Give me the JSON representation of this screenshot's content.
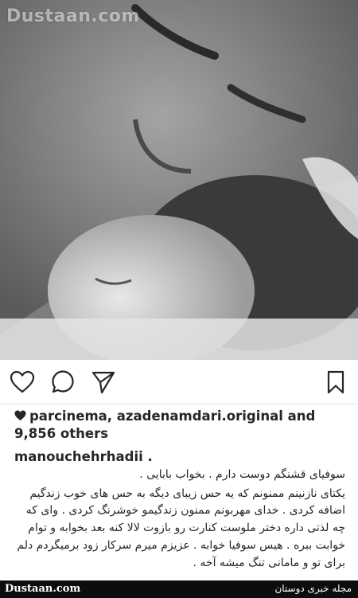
{
  "photo": {
    "description_icon": "photo-placeholder",
    "watermark": "Dustaan.com"
  },
  "actions": {
    "like_icon": "heart-icon",
    "comment_icon": "comment-icon",
    "share_icon": "send-icon",
    "save_icon": "bookmark-icon"
  },
  "post": {
    "likes_text": "parcinema, azadenamdari.original and 9,856 others",
    "username": "manouchehrhadii .",
    "caption_lines": [
      "سوفیای قشنگم دوست دارم . بخواب بابایی .",
      "یکتای نازنینم ممنونم که یه حس زیبای دیگه به حس های خوب زندگیم",
      "اضافه کردی . خدای مهربونم ممنون زندگیمو خوشرنگ کردی . وای که",
      "چه لذتی داره دختر ملوست کنارت رو بازوت لالا کنه بعد بخوابه و توام",
      "خوابت ببره . هیس سوفیا خوابه . عزیزم میرم سرکار زود برمیگردم دلم",
      "برای تو و مامانی تنگ میشه آخه ."
    ]
  },
  "footer": {
    "site_left": "Dustaan.com",
    "site_right": "مجله خبری دوستان"
  }
}
